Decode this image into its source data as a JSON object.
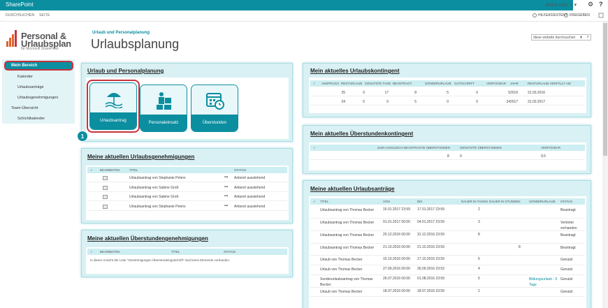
{
  "suite": {
    "brand": "SharePoint",
    "user": "demo-user-1 ▾",
    "gear": "⚙",
    "help": "?"
  },
  "ribbon": {
    "tabs": [
      "DURCHSUCHEN",
      "SEITE"
    ],
    "actions": [
      "HILFEASSISTENT",
      "FREIGEBEN"
    ]
  },
  "logo": {
    "line1": "Personal &",
    "line2": "Urlaubsplan",
    "line3": "für Microsoft SharePoint"
  },
  "breadcrumb": "Urlaub und Personalplanung",
  "page_title": "Urlaubsplanung",
  "search": {
    "placeholder": "diese website durchsuchen"
  },
  "nav": {
    "selected": "Mein Bereich",
    "items": [
      "Kalender",
      "Urlaubsanträge",
      "Urlaubsgenehmigungen",
      "Team-Übersicht",
      "Schichtkalender"
    ]
  },
  "planning": {
    "title": "Urlaub und Personalplanung",
    "tiles": [
      "Urlaubsantrag",
      "Personaleinsatz",
      "Überstunden"
    ],
    "callout": "1"
  },
  "approvals": {
    "title": "Meine aktuellen Urlaubsgenehmigungen",
    "headers": [
      "✓",
      "BEARBEITEN",
      "TITEL",
      "STATUS"
    ],
    "rows": [
      {
        "title": "Urlaubsantrag von Stephanie Peters",
        "status": "Antwort ausstehend"
      },
      {
        "title": "Urlaubsantrag von Sabine Groß",
        "status": "Antwort ausstehend"
      },
      {
        "title": "Urlaubsantrag von Sabine Groß",
        "status": "Antwort ausstehend"
      },
      {
        "title": "Urlaubsantrag von Stephanie Peters",
        "status": "Antwort ausstehend"
      }
    ]
  },
  "ot_approvals": {
    "title": "Meine aktuellen Überstundengenehmigungen",
    "headers": [
      "✓",
      "BEARBEITEN",
      "TITEL",
      "STATUS"
    ],
    "empty": "In dieser Ansicht der Liste \"Genehmigungen Überstundengutschrift\" sind keine Elemente vorhanden."
  },
  "quota": {
    "title": "Mein aktuelles Urlaubskontingent",
    "headers": [
      "✓",
      "ANSPRUCH",
      "RESTURLAUB",
      "GENUTZTE TAGE",
      "BEANTRAGT",
      "SONDERURLAUB",
      "GUTSCHRIFT",
      "VERFÜGBAR",
      "JAHR",
      "RESTURLAUB VERFÄLLT AM"
    ],
    "rows": [
      [
        "25",
        "0",
        "17",
        "8",
        "5",
        "0",
        "5",
        "2016",
        "31.03.2016"
      ],
      [
        "24",
        "5",
        "0",
        "5",
        "0",
        "0",
        "24",
        "2017",
        "31.03.2017"
      ]
    ]
  },
  "ot_quota": {
    "title": "Mein aktuelles Überstundenkontingent",
    "headers": [
      "✓",
      "ZUM AUSGLEICH BEANTRAGTE ÜBERSTUNDEN",
      "GENUTZTE ÜBERSTUNDEN",
      "VERFÜGBAR"
    ],
    "row": [
      "8",
      "0",
      "9.5"
    ]
  },
  "requests": {
    "title": "Meine aktuellen Urlaubsanträge",
    "headers": [
      "✓",
      "TITEL",
      "VON",
      "BIS",
      "DAUER IN TAGEN",
      "DAUER IN STUNDEN",
      "SONDERURLAUB",
      "STATUS"
    ],
    "rows": [
      {
        "title": "Urlaubsantrag von Thomas Becker",
        "from": "16.01.2017 23:59",
        "to": "17.01.2017 23:59",
        "days": "2",
        "hours": "",
        "special": "",
        "status": "Beantragt"
      },
      {
        "title": "Urlaubsantrag von Thomas Becker",
        "from": "01.01.2017 00:00",
        "to": "04.01.2017 23:59",
        "days": "3",
        "hours": "",
        "special": "",
        "status": "Vertreter vorhanden"
      },
      {
        "title": "Urlaubsantrag von Thomas Becker",
        "from": "20.12.2016 00:00",
        "to": "31.12.2016 23:59",
        "days": "8",
        "hours": "",
        "special": "",
        "status": "Beantragt"
      },
      {
        "title": "Urlaubsantrag von Thomas Becker",
        "from": "21.10.2016 00:00",
        "to": "21.10.2016 23:59",
        "days": "",
        "hours": "8",
        "special": "",
        "status": "Beantragt"
      },
      {
        "title": "Urlaub von Thomas Becker",
        "from": "10.10.2016 00:00",
        "to": "17.10.2016 23:59",
        "days": "6",
        "hours": "",
        "special": "",
        "status": "Genutzt"
      },
      {
        "title": "Urlaub von Thomas Becker",
        "from": "27.09.2016 00:00",
        "to": "30.09.2016 23:53",
        "days": "4",
        "hours": "",
        "special": "",
        "status": "Genutzt"
      },
      {
        "title": "Sonderurlaubsantrag von Thomas Becker",
        "from": "26.07.2016 00:00",
        "to": "01.08.2016 23:59",
        "days": "5",
        "hours": "",
        "special": "Bildungsurlaub - 5 Tage",
        "status": "Genutzt"
      },
      {
        "title": "Urlaub von Thomas Becker",
        "from": "18.07.2016 00:00",
        "to": "18.07.2016 23:59",
        "days": "1",
        "hours": "",
        "special": "",
        "status": "Genutzt"
      }
    ]
  }
}
